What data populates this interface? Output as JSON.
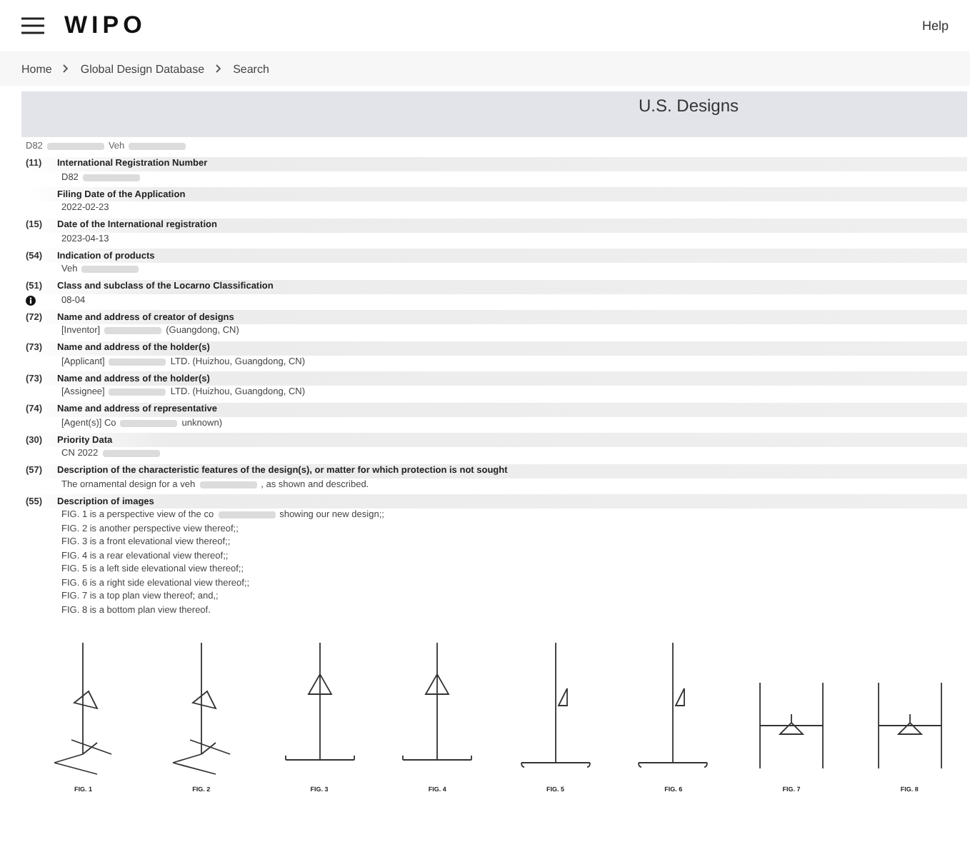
{
  "header": {
    "logo": "WIPO",
    "help": "Help"
  },
  "breadcrumb": [
    "Home",
    "Global Design Database",
    "Search"
  ],
  "banner": {
    "title": "U.S. Designs"
  },
  "heading": [
    {
      "text": "D82"
    },
    {
      "kind": "blur"
    },
    {
      "text": "Veh"
    },
    {
      "kind": "blur"
    }
  ],
  "records": [
    {
      "code": "(11)",
      "label": "International Registration Number",
      "info_icon": false,
      "lines": [
        [
          {
            "text": "D82"
          },
          {
            "kind": "blur"
          }
        ]
      ]
    },
    {
      "label": "Filing Date of the Application",
      "info_icon": false,
      "lines": [
        [
          {
            "text": "2022-02-23"
          }
        ]
      ]
    },
    {
      "code": "(15)",
      "label": "Date of the International registration",
      "info_icon": false,
      "lines": [
        [
          {
            "text": "2023-04-13"
          }
        ]
      ]
    },
    {
      "code": "(54)",
      "label": "Indication of products",
      "info_icon": false,
      "lines": [
        [
          {
            "text": "Veh"
          },
          {
            "kind": "blur"
          }
        ]
      ]
    },
    {
      "code": "(51)",
      "label": "Class and subclass of the Locarno Classification",
      "info_icon": true,
      "lines": [
        [
          {
            "text": "08-04"
          }
        ]
      ]
    },
    {
      "code": "(72)",
      "label": "Name and address of creator of designs",
      "info_icon": false,
      "lines": [
        [
          {
            "text": "[Inventor]"
          },
          {
            "kind": "blur"
          },
          {
            "text": "(Guangdong, CN)"
          }
        ]
      ]
    },
    {
      "code": "(73)",
      "label": "Name and address of the holder(s)",
      "info_icon": false,
      "lines": [
        [
          {
            "text": "[Applicant]"
          },
          {
            "kind": "blur"
          },
          {
            "text": "LTD. (Huizhou, Guangdong, CN)"
          }
        ]
      ]
    },
    {
      "code": "(73)",
      "label": "Name and address of the holder(s)",
      "info_icon": false,
      "lines": [
        [
          {
            "text": "[Assignee]"
          },
          {
            "kind": "blur"
          },
          {
            "text": "LTD. (Huizhou, Guangdong, CN)"
          }
        ]
      ]
    },
    {
      "code": "(74)",
      "label": "Name and address of representative",
      "info_icon": false,
      "lines": [
        [
          {
            "text": "[Agent(s)] Co"
          },
          {
            "kind": "blur"
          },
          {
            "text": "unknown)"
          }
        ]
      ]
    },
    {
      "code": "(30)",
      "label": "Priority Data",
      "info_icon": false,
      "lines": [
        [
          {
            "text": "CN 2022"
          },
          {
            "kind": "blur"
          }
        ]
      ]
    },
    {
      "code": "(57)",
      "label": "Description of the characteristic features of the design(s), or matter for which protection is not sought",
      "info_icon": false,
      "lines": [
        [
          {
            "text": "The ornamental design for a veh"
          },
          {
            "kind": "blur"
          },
          {
            "text": ", as shown and described."
          }
        ]
      ]
    },
    {
      "code": "(55)",
      "label": "Description of images",
      "info_icon": false,
      "lines": [
        [
          {
            "text": "FIG. 1 is a perspective view of the co"
          },
          {
            "kind": "blur"
          },
          {
            "text": "showing our new design;;"
          }
        ],
        [
          {
            "text": "FIG. 2 is another perspective view thereof;;"
          }
        ],
        [
          {
            "text": "FIG. 3 is a front elevational view thereof;;"
          }
        ],
        [
          {
            "text": "FIG. 4 is a rear elevational view thereof;;"
          }
        ],
        [
          {
            "text": "FIG. 5 is a left side elevational view thereof;;"
          }
        ],
        [
          {
            "text": "FIG. 6 is a right side elevational view thereof;;"
          }
        ],
        [
          {
            "text": "FIG. 7 is a top plan view thereof; and,;"
          }
        ],
        [
          {
            "text": "FIG. 8 is a bottom plan view thereof."
          }
        ]
      ]
    }
  ],
  "figures": [
    {
      "kind": "perspective",
      "caption": "FIG. 1"
    },
    {
      "kind": "perspective",
      "caption": "FIG. 2"
    },
    {
      "kind": "front",
      "caption": "FIG. 3"
    },
    {
      "kind": "front",
      "caption": "FIG. 4"
    },
    {
      "kind": "side",
      "caption": "FIG. 5"
    },
    {
      "kind": "side",
      "caption": "FIG. 6"
    },
    {
      "kind": "top",
      "caption": "FIG. 7"
    },
    {
      "kind": "top",
      "caption": "FIG. 8"
    }
  ]
}
